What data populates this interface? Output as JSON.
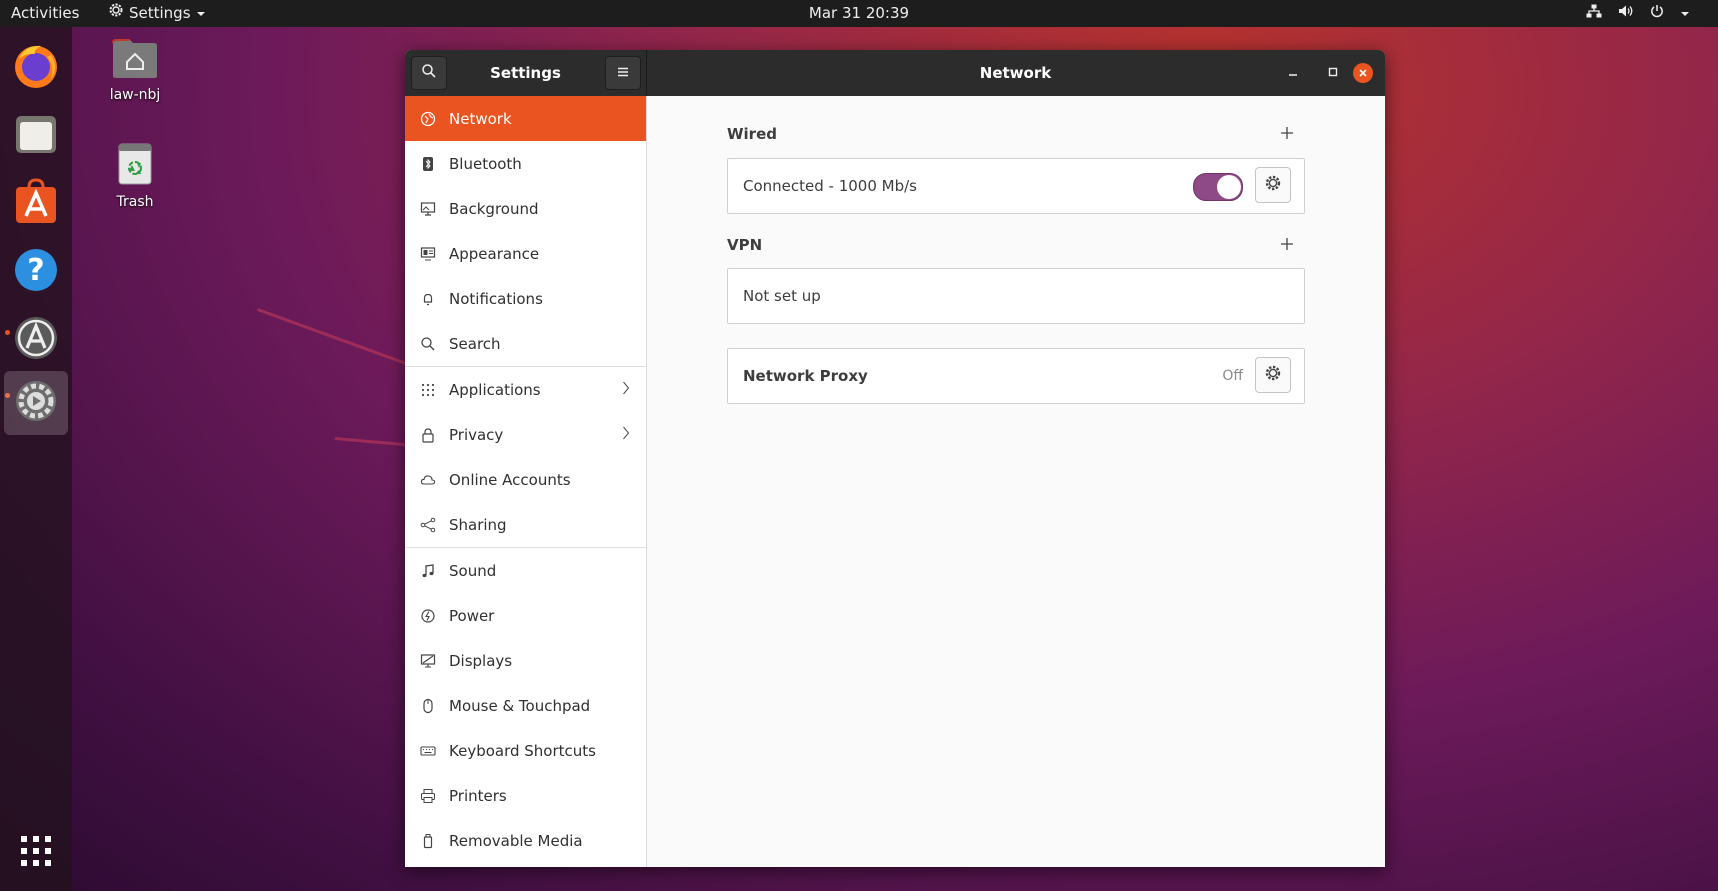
{
  "topbar": {
    "activities": "Activities",
    "app_menu_label": "Settings",
    "clock": "Mar 31  20:39"
  },
  "desktop": {
    "icons": [
      {
        "label": "law-nbj",
        "icon": "home-folder-icon"
      },
      {
        "label": "Trash",
        "icon": "trash-icon"
      }
    ]
  },
  "dock": {
    "items": [
      "firefox-icon",
      "files-icon",
      "software-store-icon",
      "help-icon",
      "software-updater-icon",
      "settings-icon",
      "show-apps-icon"
    ]
  },
  "window": {
    "sidebar_title": "Settings",
    "page_title": "Network"
  },
  "sidebar": {
    "items": [
      {
        "label": "Network",
        "icon": "network-icon"
      },
      {
        "label": "Bluetooth",
        "icon": "bluetooth-icon"
      },
      {
        "label": "Background",
        "icon": "background-icon"
      },
      {
        "label": "Appearance",
        "icon": "appearance-icon"
      },
      {
        "label": "Notifications",
        "icon": "bell-icon"
      },
      {
        "label": "Search",
        "icon": "search-icon"
      },
      {
        "label": "Applications",
        "icon": "apps-grid-icon"
      },
      {
        "label": "Privacy",
        "icon": "lock-icon"
      },
      {
        "label": "Online Accounts",
        "icon": "cloud-icon"
      },
      {
        "label": "Sharing",
        "icon": "share-icon"
      },
      {
        "label": "Sound",
        "icon": "music-note-icon"
      },
      {
        "label": "Power",
        "icon": "power-icon"
      },
      {
        "label": "Displays",
        "icon": "display-icon"
      },
      {
        "label": "Mouse & Touchpad",
        "icon": "mouse-icon"
      },
      {
        "label": "Keyboard Shortcuts",
        "icon": "keyboard-icon"
      },
      {
        "label": "Printers",
        "icon": "printer-icon"
      },
      {
        "label": "Removable Media",
        "icon": "usb-drive-icon"
      }
    ]
  },
  "network": {
    "wired_title": "Wired",
    "wired_status": "Connected - 1000 Mb/s",
    "wired_enabled": true,
    "vpn_title": "VPN",
    "vpn_status": "Not set up",
    "proxy_label": "Network Proxy",
    "proxy_state": "Off"
  },
  "colors": {
    "accent": "#e95420",
    "toggle_on": "#8e4a86",
    "headerbar": "#2c2c2c"
  }
}
